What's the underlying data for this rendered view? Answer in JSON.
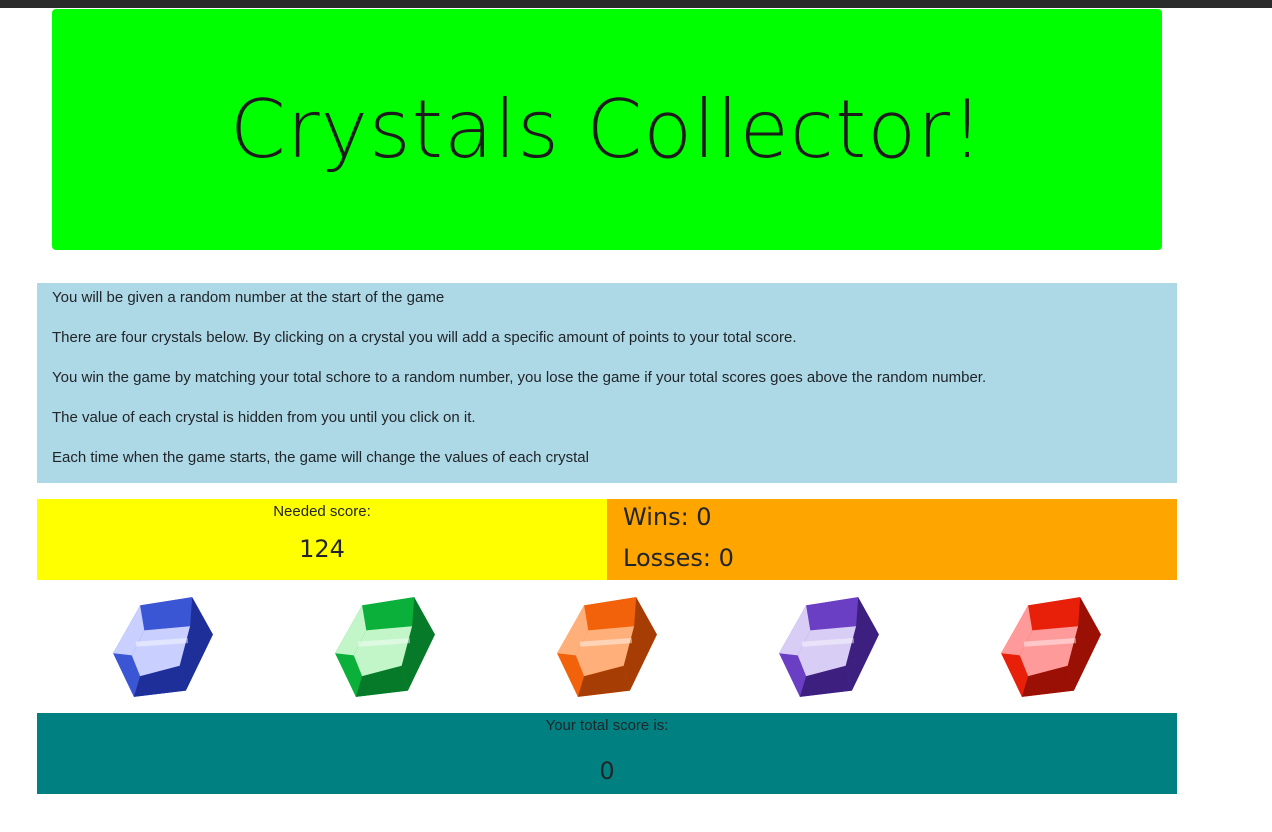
{
  "header": {
    "title": "Crystals Collector!"
  },
  "instructions": [
    "You will be given a random number at the start of the game",
    "There are four crystals below. By clicking on a crystal you will add a specific amount of points to your total score.",
    "You win the game by matching your total schore to a random number, you lose the game if your total scores goes above the random number.",
    "The value of each crystal is hidden from you until you click on it.",
    "Each time when the game starts, the game will change the values of each crystal"
  ],
  "needed": {
    "label": "Needed score:",
    "value": "124"
  },
  "record": {
    "wins": "Wins: 0",
    "losses": "Losses: 0"
  },
  "crystals": [
    {
      "name": "blue",
      "light": "#c9d0ff",
      "mid": "#3a56d4",
      "dark": "#1e2f9a"
    },
    {
      "name": "green",
      "light": "#c2f5c8",
      "mid": "#0ab03a",
      "dark": "#067a28"
    },
    {
      "name": "orange",
      "light": "#ffb07a",
      "mid": "#f2620a",
      "dark": "#a63d04"
    },
    {
      "name": "purple",
      "light": "#d8cdf5",
      "mid": "#6b3fc4",
      "dark": "#3d1f80"
    },
    {
      "name": "red",
      "light": "#ff9a9a",
      "mid": "#e8200a",
      "dark": "#9a1005"
    }
  ],
  "total": {
    "label": "Your total score is:",
    "value": "0"
  },
  "colors": {
    "header_bg": "#00ff00",
    "instructions_bg": "#add8e6",
    "needed_bg": "#ffff00",
    "record_bg": "#ffa500",
    "total_bg": "#008080"
  }
}
